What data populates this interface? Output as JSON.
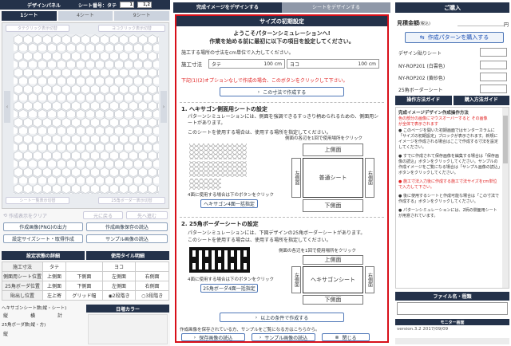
{
  "left_panel": {
    "title": "デザインパネル",
    "sheet_no_label": "シート番号：タテ",
    "sheet_no_value": "1",
    "sheet_no_value2": "1,2",
    "tabs": [
      "1シート",
      "4シート",
      "9シート"
    ],
    "tap_select": "タテクリック表示切替",
    "yoko_select": "ヨコクリック表示切替",
    "sheet_list_btn": "シート一覧表示切替",
    "border_btn": "25角ボーダー表示切替",
    "clear_btn": "作成表示をクリア",
    "back_btn": "元に戻る",
    "forward_btn": "先へ進む",
    "png_output_btn": "作成画像(PNG)の出力",
    "save_img_btn": "作成画像保存の読込",
    "settings_btn": "設定サイズシート・取得作成",
    "sample_btn": "サンプル画像の読込",
    "settings_header": "設定状態の詳細",
    "tile_header": "使用タイル明細",
    "rows": [
      {
        "label": "施工寸法",
        "c1": "タテ",
        "c2": "",
        "c3": "ヨコ",
        "c4": ""
      },
      {
        "label": "側面用シート位置",
        "c1": "上側面",
        "c2": "下側面",
        "c3": "左側面",
        "c4": "右側面"
      },
      {
        "label": "25角ボーダ位置",
        "c1": "上側面",
        "c2": "下側面",
        "c3": "左側面",
        "c4": "右側面"
      },
      {
        "label": "貼出し位置",
        "c1": "左上寄",
        "c2": "グリッド幅",
        "c3": "2段階き",
        "c4": "3段階き"
      }
    ],
    "hex_count_label": "ヘキサゴンシート数(縦・シート)",
    "color_header": "日増カラー",
    "vert_label": "縦",
    "horiz_label": "横",
    "total_label": "計",
    "border_count_label": "25角ボーダ数(縦・方)",
    "vert_label2": "縦"
  },
  "center": {
    "tabs": [
      "完成イメージをデザインする",
      "シートをデザインする"
    ],
    "modal_title": "サイズの初期設定",
    "welcome_line1": "ようこそパターンシミュレーションへ!",
    "welcome_line2": "作業を始める前に最初に以下の項目を設定してください。",
    "instruction": "施工する場所の寸法をcm単位で入力してください。",
    "size_label": "施工寸法",
    "tate_label": "タテ",
    "tate_value": "100",
    "yoko_label": "ヨコ",
    "yoko_value": "100",
    "unit": "cm",
    "optional_note": "下記(1)(2)オプションなしで作成の場合、このボタンをクリックして下さい。",
    "create_btn1": "この寸法で作成する",
    "section1_title": "1. ヘキサゴン側面用シートの設定",
    "section1_desc1": "パターンシミュレーションには、側面を強調できるすっきり柄められるための、側面用シートがあります。",
    "section1_desc2": "このシートを使用する場合は、使用する場所を指定してください。",
    "section1_hint": "側面の各辺を1回で使用場所をクリック",
    "section1_link": "4面に使用する場合は下のボタンをクリック",
    "section1_btn": "ヘキサゴン4面一括指定",
    "pos_top": "上側面",
    "pos_bottom": "下側面",
    "pos_left": "左側面",
    "pos_right": "右側面",
    "normal_sheet": "普通シート",
    "section2_title": "2. 25角ボーダーシートの設定",
    "section2_desc1": "パターンシミュレーションには、下図デザインの25角ボーダーシートがあります。",
    "section2_desc2": "このシートを使用する場合は、使用する場所を指定してください。",
    "section2_hint": "側面の各辺を1回で使用場所をクリック",
    "section2_link": "4面に使用する場合は下のボタンをクリック",
    "section2_btn": "25角ボーダ4面一括指定",
    "hex_sheet": "ヘキサゴンシート",
    "create_btn2": "以上の条件で作成する",
    "footer_note": "作成画像を保存されている方、サンプルをご覧になる方はこちらから。",
    "load_save_btn": "保存画像の読込",
    "load_sample_btn": "サンプル画像の読込",
    "close_btn": "閉じる"
  },
  "right": {
    "order_header": "ご購入",
    "estimate_label": "見積金額",
    "estimate_sub": "(税込)",
    "yen": "円",
    "buy_btn": "作成パターンを購入する",
    "design_sheet_label": "デザイン貼りシート",
    "item1": "NY-ROP201 (白雲色)",
    "item2": "NY-ROP202 (黄砂色)",
    "item3": "25角ボーダーシート",
    "guide_tab1": "操作方法ガイド",
    "guide_tab2": "購入方法ガイド",
    "guide_title": "完成イメージデザイン作成操作方法",
    "guide_red1": "色の部分の画像にマウスオーバーすると その画像",
    "guide_red2": "が全体で表示されます",
    "guide_items": [
      "このページを開いた初期画面ではセンターカラムに「サイズの初期設定」ブロックが表示されます。新規にイメージを作成される場合はここで作成する寸法を設定してください。",
      "すでに作成されて保存画像を編集する場合は「保存画像の読込」ボタンをクリックしてください。サンプルの作成イメージをご覧になる場合は「サンプル画像の読込」ボタンをクリックしてください。",
      "施工寸法入力後に作成する施工寸法サイズをcm単位で入力して下さい。",
      "後に使用するシートと作成可能な場合は「この寸法で作成する」ボタンをクリックしてください。",
      "パターンシミュレーションには、2柄の側面用シートが用意されています。"
    ],
    "filename_header": "ファイル名・程類",
    "monitor_header": "モニター画面",
    "version": "version.3.2 2017/09/09"
  },
  "colors": {
    "navy": "#24324a",
    "red_border": "#d8101a",
    "light_blue": "#eef3fa",
    "sheet_cell": "#f4f4f4"
  }
}
